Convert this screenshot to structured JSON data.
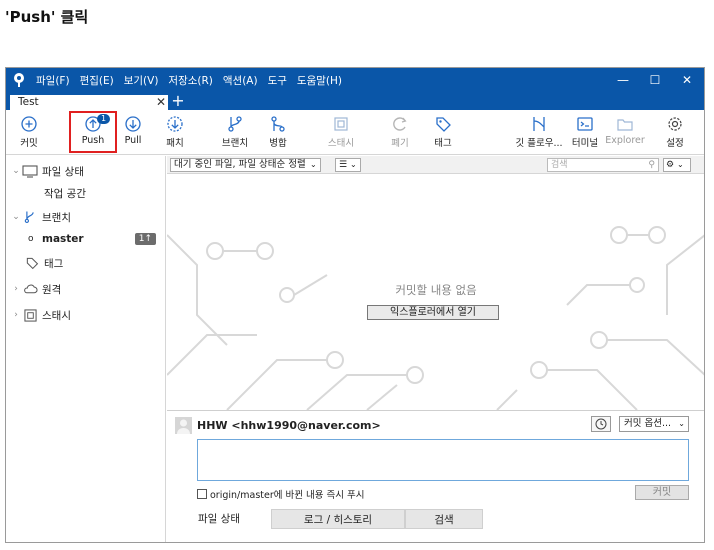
{
  "caption": "'Push' 클릭",
  "app": {
    "menu": [
      "파일(F)",
      "편집(E)",
      "보기(V)",
      "저장소(R)",
      "액션(A)",
      "도구",
      "도움말(H)"
    ],
    "window_controls": {
      "minimize": "—",
      "maximize": "☐",
      "close": "✕"
    }
  },
  "tabs": {
    "active_label": "Test",
    "close": "✕",
    "add": "+"
  },
  "toolbar": {
    "commit": "커밋",
    "push": "Push",
    "push_badge": "1",
    "pull": "Pull",
    "fetch": "패치",
    "branch": "브랜치",
    "merge": "병합",
    "stash": "스태시",
    "discard": "폐기",
    "tag": "태그",
    "git_flow": "깃 플로우...",
    "terminal": "터미널",
    "explorer": "Explorer",
    "settings": "설정"
  },
  "sidebar": {
    "file_status": "파일 상태",
    "workspace": "작업 공간",
    "branches": "브랜치",
    "master": "master",
    "master_count": "1↑",
    "tags": "태그",
    "remotes": "원격",
    "stashes": "스태시"
  },
  "filterbar": {
    "sort": "대기 중인 파일, 파일 상태순 정렬",
    "list_icon": "☰",
    "search_placeholder": "검색",
    "gear": "⚙"
  },
  "main": {
    "empty_message": "커밋할 내용 없음",
    "open_explorer": "익스플로러에서 열기"
  },
  "commit": {
    "author": "HHW <hhw1990@naver.com>",
    "options": "커밋 옵션...",
    "push_immediately": "origin/master에 바뀐 내용 즉시 푸시",
    "commit_button": "커밋"
  },
  "bottom_tabs": [
    "파일 상태",
    "로그 / 히스토리",
    "검색"
  ],
  "colors": {
    "titlebar": "#0a56a8",
    "highlight": "#e02020"
  }
}
